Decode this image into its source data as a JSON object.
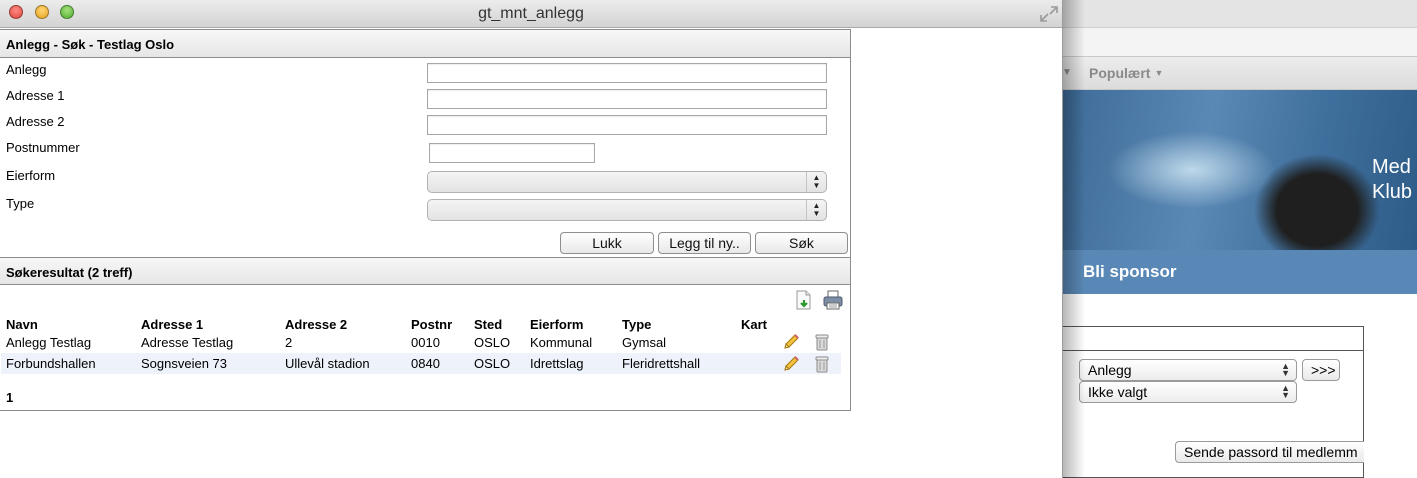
{
  "window": {
    "title": "gt_mnt_anlegg"
  },
  "search_section": {
    "title": "Anlegg - Søk - Testlag Oslo",
    "fields": {
      "anlegg": {
        "label": "Anlegg",
        "value": ""
      },
      "adresse1": {
        "label": "Adresse 1",
        "value": ""
      },
      "adresse2": {
        "label": "Adresse 2",
        "value": ""
      },
      "postnummer": {
        "label": "Postnummer",
        "value": ""
      },
      "eierform": {
        "label": "Eierform",
        "selected": ""
      },
      "type": {
        "label": "Type",
        "selected": ""
      }
    },
    "buttons": {
      "close": "Lukk",
      "add_new": "Legg til ny..",
      "search": "Søk"
    }
  },
  "results": {
    "title": "Søkeresultat (2 treff)",
    "toolbar_icons": [
      "export-icon",
      "print-icon"
    ],
    "columns": {
      "navn": "Navn",
      "adresse1": "Adresse 1",
      "adresse2": "Adresse 2",
      "postnr": "Postnr",
      "sted": "Sted",
      "eierform": "Eierform",
      "type": "Type",
      "kart": "Kart"
    },
    "rows": [
      {
        "navn": "Anlegg Testlag",
        "adresse1": "Adresse Testlag",
        "adresse2": "2",
        "postnr": "0010",
        "sted": "OSLO",
        "eierform": "Kommunal",
        "type": "Gymsal",
        "kart": ""
      },
      {
        "navn": "Forbundshallen",
        "adresse1": "Sognsveien 73",
        "adresse2": "Ullevål stadion",
        "postnr": "0840",
        "sted": "OSLO",
        "eierform": "Idrettslag",
        "type": "Fleridrettshall",
        "kart": ""
      }
    ],
    "row_icons": [
      "edit-pencil-icon",
      "delete-trash-icon"
    ],
    "pagination": "1"
  },
  "background_page": {
    "nav_item": "Populært",
    "banner_text_1": "Med",
    "banner_text_2": "Klub",
    "sponsor_heading": "Bli sponsor",
    "select_1": "Anlegg",
    "select_1_button": ">>>",
    "select_2": "Ikke valgt",
    "send_button": "Sende passord til medlemm"
  },
  "colors": {
    "titlebar": "#dcdcdc",
    "row_highlight": "#edf2fb",
    "sponsor_bar": "#5a88b6",
    "banner": "#4a78a6"
  }
}
